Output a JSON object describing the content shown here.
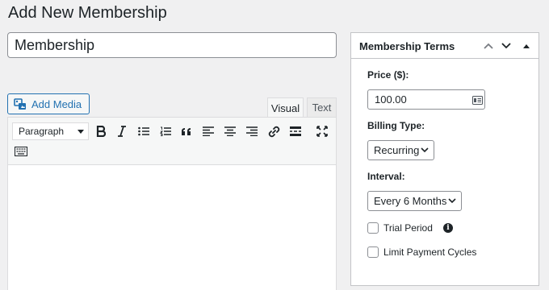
{
  "page": {
    "title": "Add New Membership",
    "title_value": "Membership"
  },
  "editor": {
    "add_media_label": "Add Media",
    "tabs": {
      "visual": "Visual",
      "text": "Text"
    },
    "format_select": "Paragraph",
    "toolbar_icons": [
      "bold-icon",
      "italic-icon",
      "bulleted-list-icon",
      "numbered-list-icon",
      "blockquote-icon",
      "align-left-icon",
      "align-center-icon",
      "align-right-icon",
      "link-icon",
      "read-more-icon",
      "fullscreen-icon",
      "toolbar-toggle-icon"
    ]
  },
  "terms_panel": {
    "title": "Membership Terms",
    "price_label": "Price ($):",
    "price_value": "100.00",
    "billing_label": "Billing Type:",
    "billing_value": "Recurring",
    "interval_label": "Interval:",
    "interval_value": "Every 6 Months",
    "trial_label": "Trial Period",
    "limit_label": "Limit Payment Cycles"
  }
}
